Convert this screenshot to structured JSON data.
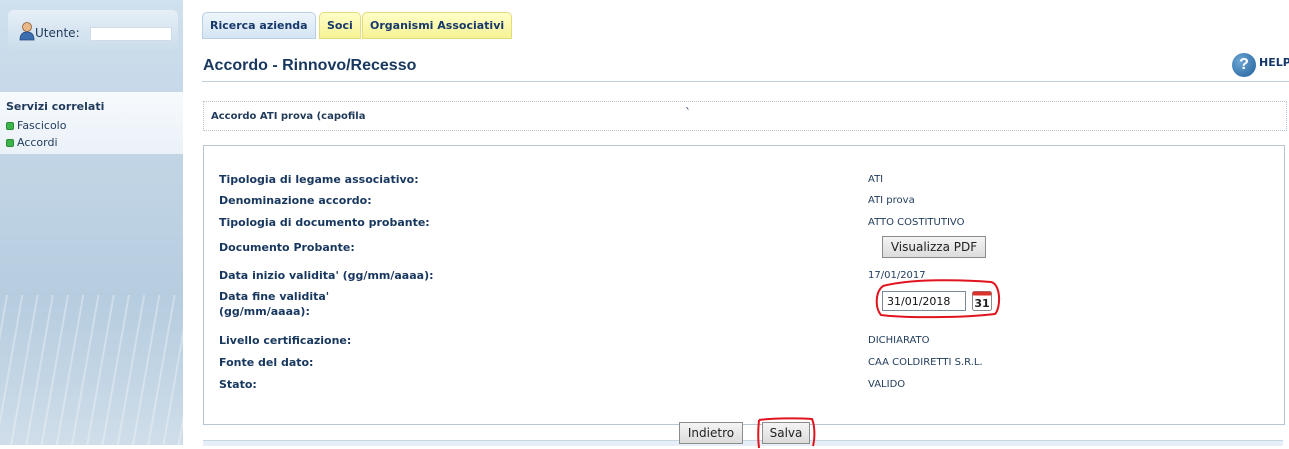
{
  "sidebar": {
    "user_label": "Utente:",
    "user_value": "",
    "services_title": "Servizi correlati",
    "items": [
      {
        "label": "Fascicolo"
      },
      {
        "label": "Accordi"
      }
    ]
  },
  "tabs": [
    {
      "label": "Ricerca azienda"
    },
    {
      "label": "Soci"
    },
    {
      "label": "Organismi Associativi"
    }
  ],
  "header": {
    "title": "Accordo - Rinnovo/Recesso",
    "help_label": "HELP",
    "help_glyph": "?"
  },
  "accordo": {
    "name": "Accordo ATI prova (capofila",
    "mark": "`"
  },
  "detail": {
    "rows": [
      {
        "label": "Tipologia di legame associativo:",
        "value": "ATI"
      },
      {
        "label": "Denominazione accordo:",
        "value": "ATI prova"
      },
      {
        "label": "Tipologia di documento probante:",
        "value": "ATTO COSTITUTIVO"
      },
      {
        "label": "Documento Probante:",
        "value": ""
      },
      {
        "label": "Data inizio validita' (gg/mm/aaaa):",
        "value": "17/01/2017"
      },
      {
        "label": "Data fine validita'",
        "label2": "(gg/mm/aaaa):",
        "value": ""
      },
      {
        "label": "Livello certificazione:",
        "value": "DICHIARATO"
      },
      {
        "label": "Fonte del dato:",
        "value": "CAA COLDIRETTI S.R.L."
      },
      {
        "label": "Stato:",
        "value": "VALIDO"
      }
    ],
    "pdf_button_label": "Visualizza PDF",
    "end_date_value": "31/01/2018",
    "calendar_day": "31"
  },
  "actions": {
    "back_label": "Indietro",
    "save_label": "Salva"
  },
  "colors": {
    "highlight": "#e0141e",
    "status_dot": "#3cb54a",
    "title": "#17375e"
  }
}
